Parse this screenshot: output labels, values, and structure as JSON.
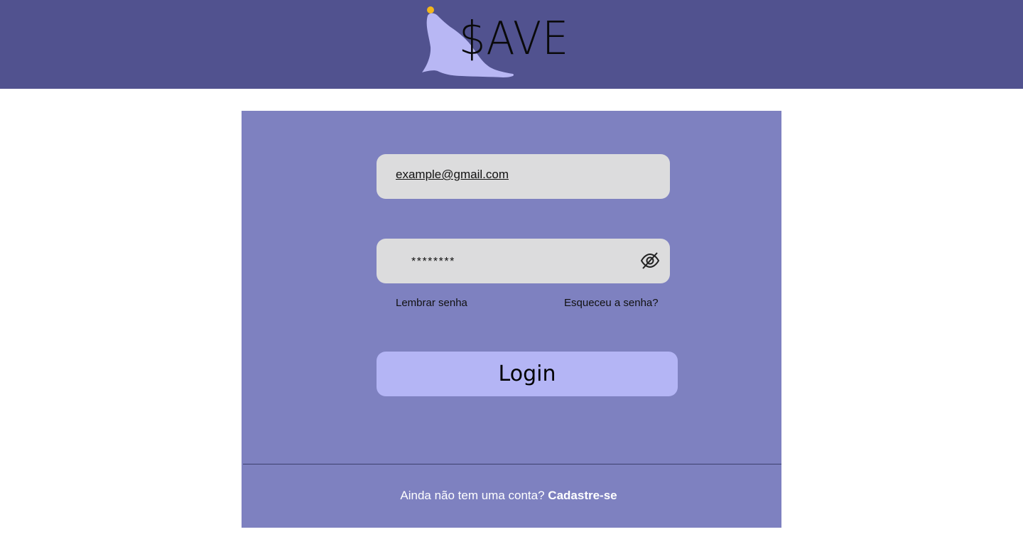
{
  "header": {
    "logo_text": "$AVE",
    "background_color": "#51528f",
    "logo_icon": "seal-icon"
  },
  "login_form": {
    "email_value": "example@gmail.com",
    "password_value": "********",
    "password_toggle_icon": "eye-slash-icon",
    "remember_label": "Lembrar senha",
    "forgot_label": "Esqueceu a senha?",
    "login_label": "Login",
    "card_color": "#7e81c0",
    "button_color": "#b4b5f5"
  },
  "footer": {
    "prompt_text": "Ainda não tem uma conta?",
    "signup_link": "Cadastre-se"
  }
}
